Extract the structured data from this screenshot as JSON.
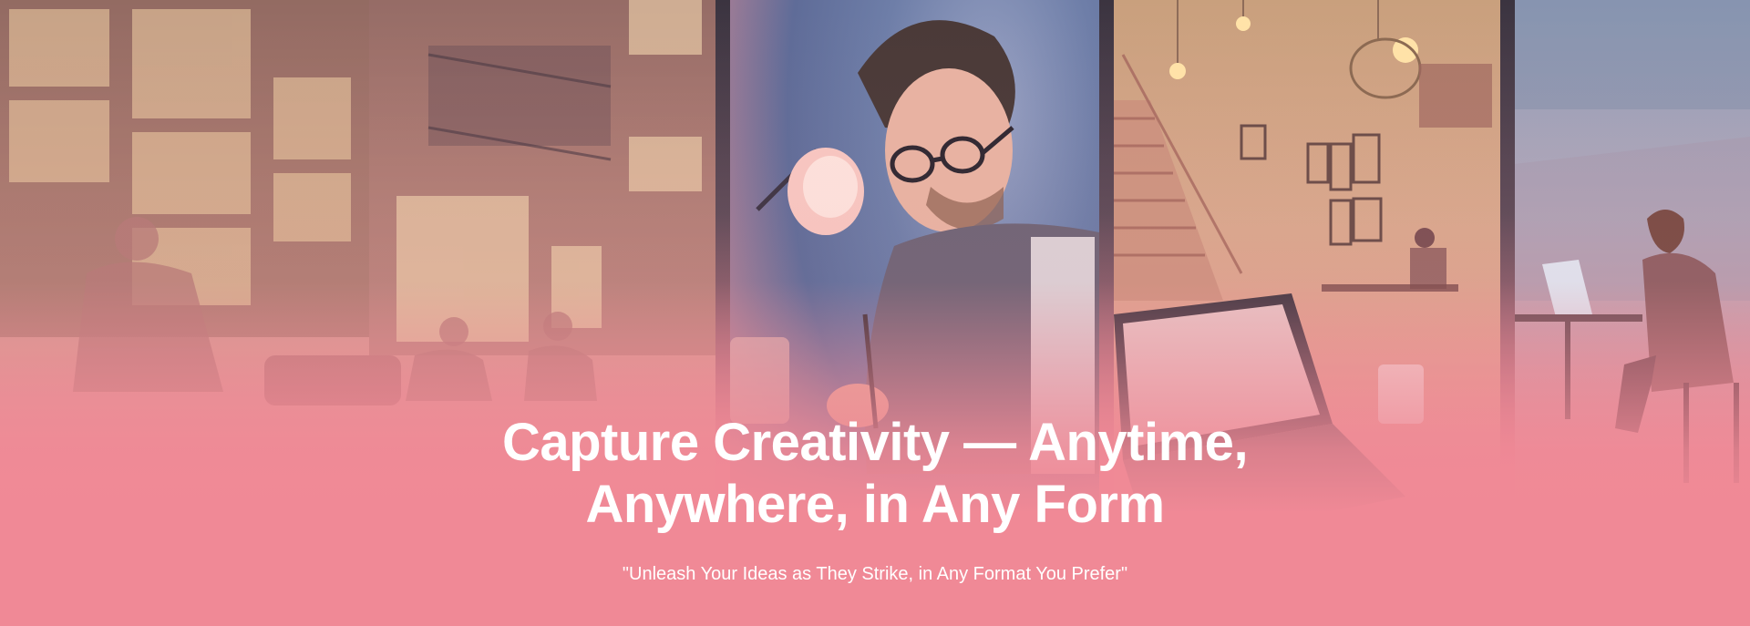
{
  "hero": {
    "headline_line1": "Capture Creativity — Anytime,",
    "headline_line2": "Anywhere, in Any Form",
    "tagline": "\"Unleash Your Ideas as They Strike, in Any Format You Prefer\""
  },
  "colors": {
    "background": "#f08996",
    "text": "#ffffff"
  }
}
